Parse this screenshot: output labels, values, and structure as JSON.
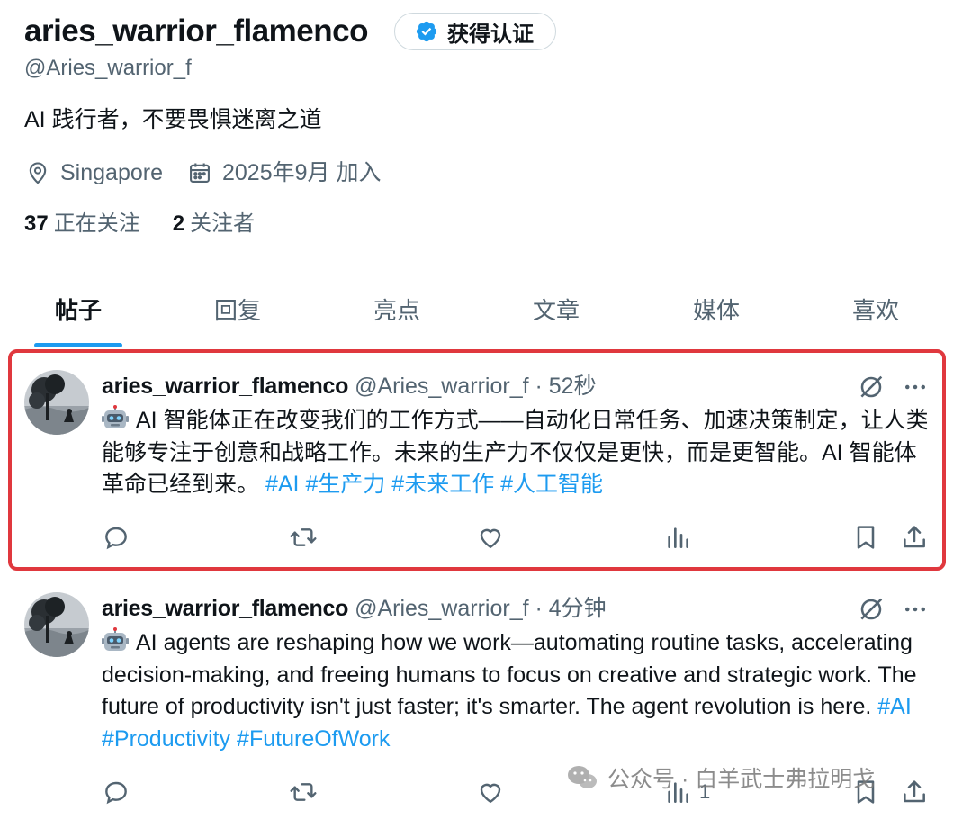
{
  "profile": {
    "display_name": "aries_warrior_flamenco",
    "verify_label": "获得认证",
    "handle": "@Aries_warrior_f",
    "bio": "AI 践行者，不要畏惧迷离之道",
    "location": "Singapore",
    "joined": "2025年9月 加入",
    "following_count": "37",
    "following_label": "正在关注",
    "followers_count": "2",
    "followers_label": "关注者"
  },
  "tabs": [
    "帖子",
    "回复",
    "亮点",
    "文章",
    "媒体",
    "喜欢"
  ],
  "active_tab": "帖子",
  "posts": [
    {
      "author": "aries_warrior_flamenco",
      "handle": "@Aries_warrior_f",
      "sep": "·",
      "time": "52秒",
      "text": "AI 智能体正在改变我们的工作方式——自动化日常任务、加速决策制定，让人类能够专注于创意和战略工作。未来的生产力不仅仅是更快，而是更智能。AI 智能体革命已经到来。",
      "hashtags": "#AI #生产力 #未来工作 #人工智能",
      "highlighted": true
    },
    {
      "author": "aries_warrior_flamenco",
      "handle": "@Aries_warrior_f",
      "sep": "·",
      "time": "4分钟",
      "text": "AI agents are reshaping how we work—automating routine tasks, accelerating decision-making, and freeing humans to focus on creative and strategic work. The future of productivity isn't just faster; it's smarter. The agent revolution is here.",
      "hashtags": "#AI #Productivity #FutureOfWork",
      "views": "1",
      "highlighted": false
    }
  ],
  "watermark": {
    "text": "公众号 · 白羊武士弗拉明戈"
  },
  "colors": {
    "accent": "#1d9bf0",
    "highlight_border": "#e0383e",
    "secondary_text": "#536471",
    "primary_text": "#0f1419"
  }
}
